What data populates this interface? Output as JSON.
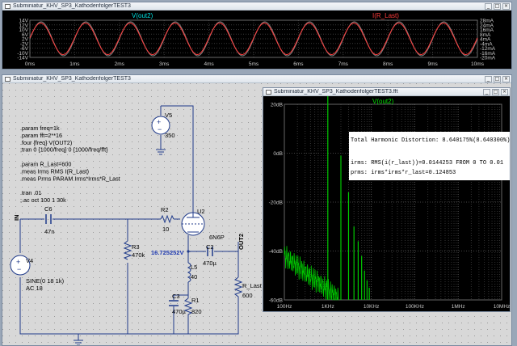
{
  "top_window": {
    "title": "Subminiatur_KHV_SP3_KathodenfolgerTEST3",
    "trace1": "V(out2)",
    "trace2": "I(R_Last)",
    "left_axis": [
      "14V",
      "12V",
      "10V",
      "6V",
      "2V",
      "-2V",
      "-6V",
      "-10V",
      "-14V"
    ],
    "right_axis": [
      "28mA",
      "24mA",
      "16mA",
      "8mA",
      "4mA",
      "-4mA",
      "-12mA",
      "-16mA",
      "-20mA"
    ],
    "time_ticks": [
      "0ms",
      "1ms",
      "2ms",
      "3ms",
      "4ms",
      "5ms",
      "6ms",
      "7ms",
      "8ms",
      "9ms",
      "10ms"
    ],
    "colors": {
      "v_trace": "#808080",
      "i_trace": "#ff3b3b",
      "bg": "#000000",
      "grid": "#4a4a4a"
    }
  },
  "schematic_window": {
    "title": "Subminiatur_KHV_SP3_KathodenfolgerTEST3",
    "directives": [
      ".param freq=1k",
      ".param fft=2**16",
      ".four {freq} V(OUT2)",
      ";tran 0 {1000/freq} 0 {1000/freq/fft}",
      "",
      ".param R_Last=600",
      ".meas Irms RMS I(R_Last)",
      ".meas Prms PARAM Irms*Irms*R_Last",
      "",
      ".tran .01",
      ";.ac oct 100 1 30k"
    ],
    "labels": {
      "in": "IN",
      "out2": "OUT2",
      "node_voltage": "16.725252V",
      "v5": "V5",
      "v5_val": "350",
      "v4": "V4",
      "v4_val1": "SINE(0 18 1k)",
      "v4_val2": "AC 18",
      "c6": "C6",
      "c6_val": "47n",
      "r2": "R2",
      "r2_val": "10",
      "r3": "R3",
      "r3_val": "470k",
      "u2": "U2",
      "u2_val": "6N6P",
      "c2": "C2",
      "c2_val": "470µ",
      "l5": "L5",
      "l5_val": "40",
      "c3": "C3",
      "c3_val": "470µ",
      "r1": "R1",
      "r1_val": "820",
      "rlast": "R_Last",
      "rlast_val": "600"
    }
  },
  "fft_window": {
    "title": "Subminiatur_KHV_SP3_KathodenfolgerTEST3.fft",
    "trace": "V(out2)",
    "y_ticks": [
      "20dB",
      "0dB",
      "-20dB",
      "-40dB",
      "-60dB"
    ],
    "x_ticks": [
      "100Hz",
      "1KHz",
      "10KHz",
      "100KHz",
      "1MHz",
      "10MHz"
    ],
    "thd": "Total Harmonic Distortion: 8.640175%(8.640300%)",
    "irms": "irms: RMS(i(r_last))=0.0144253 FROM 0 TO 0.01",
    "prms": "prms: irms*irms*r_last=0.124853",
    "trace_color": "#00c800"
  },
  "window_buttons": {
    "min": "_",
    "max": "□",
    "close": "×"
  }
}
